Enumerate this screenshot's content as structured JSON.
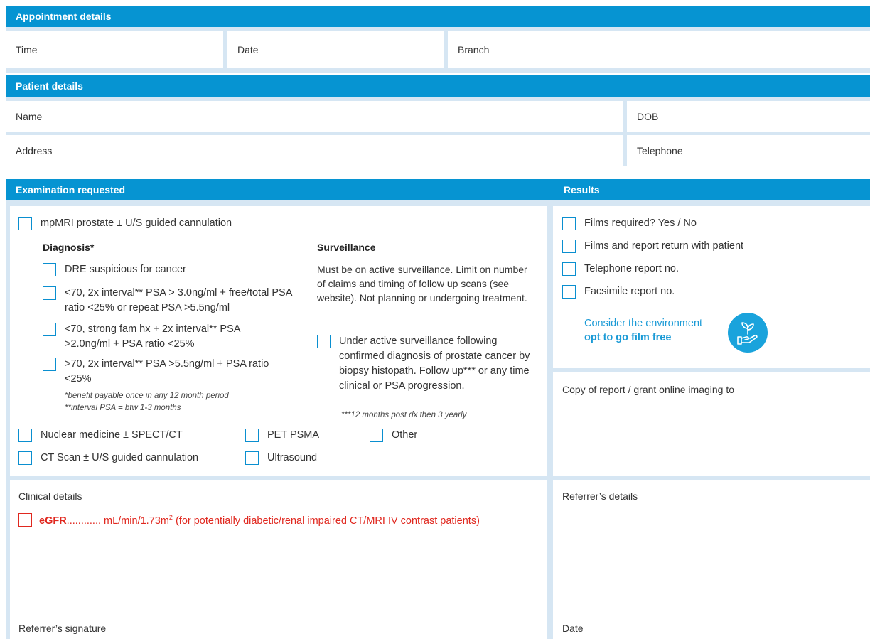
{
  "appointment": {
    "header": "Appointment details",
    "fields": [
      "Time",
      "Date",
      "Branch"
    ]
  },
  "patient": {
    "header": "Patient details",
    "name_label": "Name",
    "dob_label": "DOB",
    "address_label": "Address",
    "telephone_label": "Telephone"
  },
  "exam": {
    "header": "Examination requested",
    "mpmri": "mpMRI prostate ± U/S guided cannulation",
    "diagnosis_title": "Diagnosis*",
    "diagnosis_items": [
      "DRE suspicious for cancer",
      "<70, 2x interval** PSA > 3.0ng/ml + free/total PSA ratio <25% or repeat PSA >5.5ng/ml",
      "<70, strong fam hx + 2x interval** PSA >2.0ng/ml + PSA ratio <25%",
      ">70, 2x interval** PSA >5.5ng/ml + PSA ratio <25%"
    ],
    "diagnosis_note_1": "*benefit payable once in any 12 month period",
    "diagnosis_note_2": "**interval PSA = btw 1-3 months",
    "surveillance_title": "Surveillance",
    "surveillance_text": "Must be on active surveillance. Limit on number of claims and timing of follow up scans (see website). Not planning or undergoing treatment.",
    "surveillance_item": "Under active surveillance following confirmed diagnosis of prostate cancer by biopsy histopath. Follow up*** or any time clinical or PSA progression.",
    "surveillance_note": "***12 months post dx then 3 yearly",
    "other_items": {
      "nuclear": "Nuclear medicine ± SPECT/CT",
      "pet": "PET PSMA",
      "other": "Other",
      "ct": "CT Scan ± U/S guided cannulation",
      "ultrasound": "Ultrasound"
    }
  },
  "results": {
    "header": "Results",
    "items": [
      "Films required?  Yes / No",
      "Films and report return with patient",
      "Telephone report no.",
      "Facsimile report no."
    ],
    "eco_line1": "Consider the environment",
    "eco_line2": "opt to go film free",
    "eco_icon": "plant-in-hand-icon",
    "copy_label": "Copy of report / grant online imaging to"
  },
  "clinical": {
    "label": "Clinical details",
    "egfr_bold": "eGFR",
    "egfr_dots": "............",
    "egfr_unit": " mL/min/1.73m",
    "egfr_sup": "2",
    "egfr_rest": " (for potentially diabetic/renal impaired CT/MRI IV contrast patients)",
    "signature_label": "Referrer’s signature"
  },
  "referrer": {
    "label": "Referrer’s details",
    "date_label": "Date"
  },
  "colors": {
    "header_blue": "#0694d2",
    "band": "#d6e6f3",
    "checkbox_blue": "#0a8fd0",
    "alert_red": "#e0281f"
  }
}
